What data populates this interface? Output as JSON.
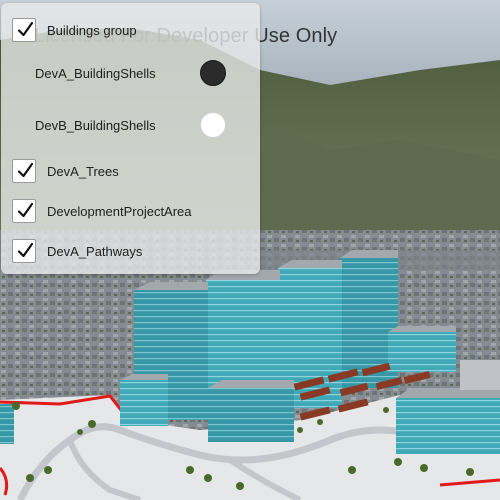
{
  "watermark": "Licensed For Developer Use Only",
  "layers_panel": {
    "group": {
      "label": "Buildings group",
      "checked": true
    },
    "radios": [
      {
        "label": "DevA_BuildingShells",
        "selected": true
      },
      {
        "label": "DevB_BuildingShells",
        "selected": false
      }
    ],
    "layers": [
      {
        "label": "DevA_Trees",
        "checked": true
      },
      {
        "label": "DevelopmentProjectArea",
        "checked": true
      },
      {
        "label": "DevA_Pathways",
        "checked": true
      }
    ]
  },
  "colors": {
    "building_glass": "#3fa9b8",
    "roof": "#9aa0a6",
    "project_boundary": "#e21a1a",
    "pathway": "#bfc3c7",
    "small_roof": "#8a3a24"
  }
}
